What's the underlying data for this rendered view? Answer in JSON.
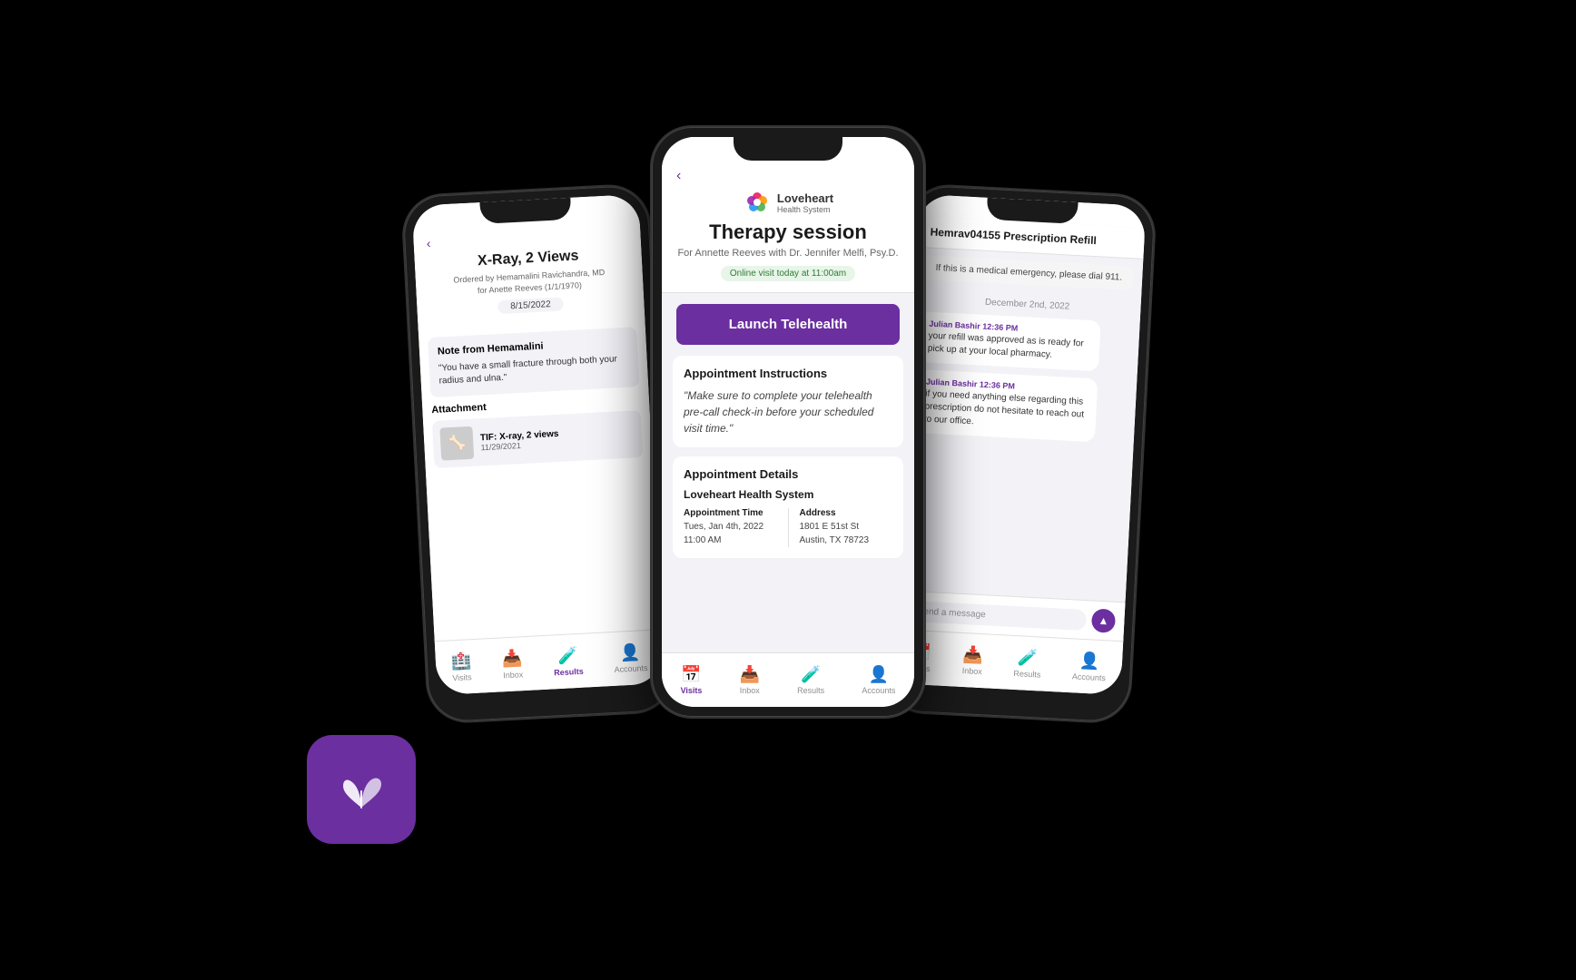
{
  "background": "#000000",
  "app_icon": {
    "bg_color": "#6b2fa0",
    "alt": "Loveheart Health App"
  },
  "left_phone": {
    "screen_title": "X-Ray, 2 Views",
    "ordered_by": "Ordered by Hemamalini Ravichandra, MD",
    "for_patient": "for Anette Reeves (1/1/1970)",
    "date": "8/15/2022",
    "note_from": "Note from Hemamalini",
    "note_text": "\"You have a small fracture through both your radius and ulna.\"",
    "attachment_label": "Attachment",
    "attachment_name": "TIF: X-ray, 2 views",
    "attachment_date": "11/29/2021",
    "nav": {
      "items": [
        {
          "label": "Visits",
          "active": false
        },
        {
          "label": "Inbox",
          "active": false
        },
        {
          "label": "Results",
          "active": true
        },
        {
          "label": "Accounts",
          "active": false
        }
      ]
    }
  },
  "center_phone": {
    "logo_name": "Loveheart",
    "logo_sub": "Health System",
    "title": "Therapy session",
    "subtitle": "For Annette Reeves with Dr. Jennifer Melfi, Psy.D.",
    "online_badge": "Online visit today at 11:00am",
    "launch_button": "Launch Telehealth",
    "appointment_instructions_title": "Appointment Instructions",
    "instructions_quote": "\"Make sure to complete your telehealth pre-call check-in before your scheduled visit time.\"",
    "appointment_details_title": "Appointment Details",
    "provider": "Loveheart Health System",
    "appt_time_label": "Appointment Time",
    "appt_time_value": "Tues, Jan 4th, 2022",
    "appt_time_value2": "11:00 AM",
    "address_label": "Address",
    "address_line1": "1801 E 51st St",
    "address_line2": "Austin, TX 78723",
    "nav": {
      "items": [
        {
          "label": "Visits",
          "active": true
        },
        {
          "label": "Inbox",
          "active": false
        },
        {
          "label": "Results",
          "active": false
        },
        {
          "label": "Accounts",
          "active": false
        }
      ]
    }
  },
  "right_phone": {
    "title": "Hemrav04155 Prescription Refill",
    "emergency_text": "If this is a medical emergency, please dial 911.",
    "date_label": "December 2nd, 2022",
    "messages": [
      {
        "sender": "Julian Bashir 12:36 PM",
        "text": "your refill was approved as is ready for pick up at your local pharmacy."
      },
      {
        "sender": "Julian Bashir 12:36 PM",
        "text": "if you need anything else regarding this prescription do not hesitate to reach out to our office."
      }
    ],
    "input_placeholder": "Send a message",
    "nav": {
      "items": [
        {
          "label": "Visits",
          "active": false
        },
        {
          "label": "Inbox",
          "active": false
        },
        {
          "label": "Results",
          "active": false
        },
        {
          "label": "Accounts",
          "active": false
        }
      ]
    }
  }
}
